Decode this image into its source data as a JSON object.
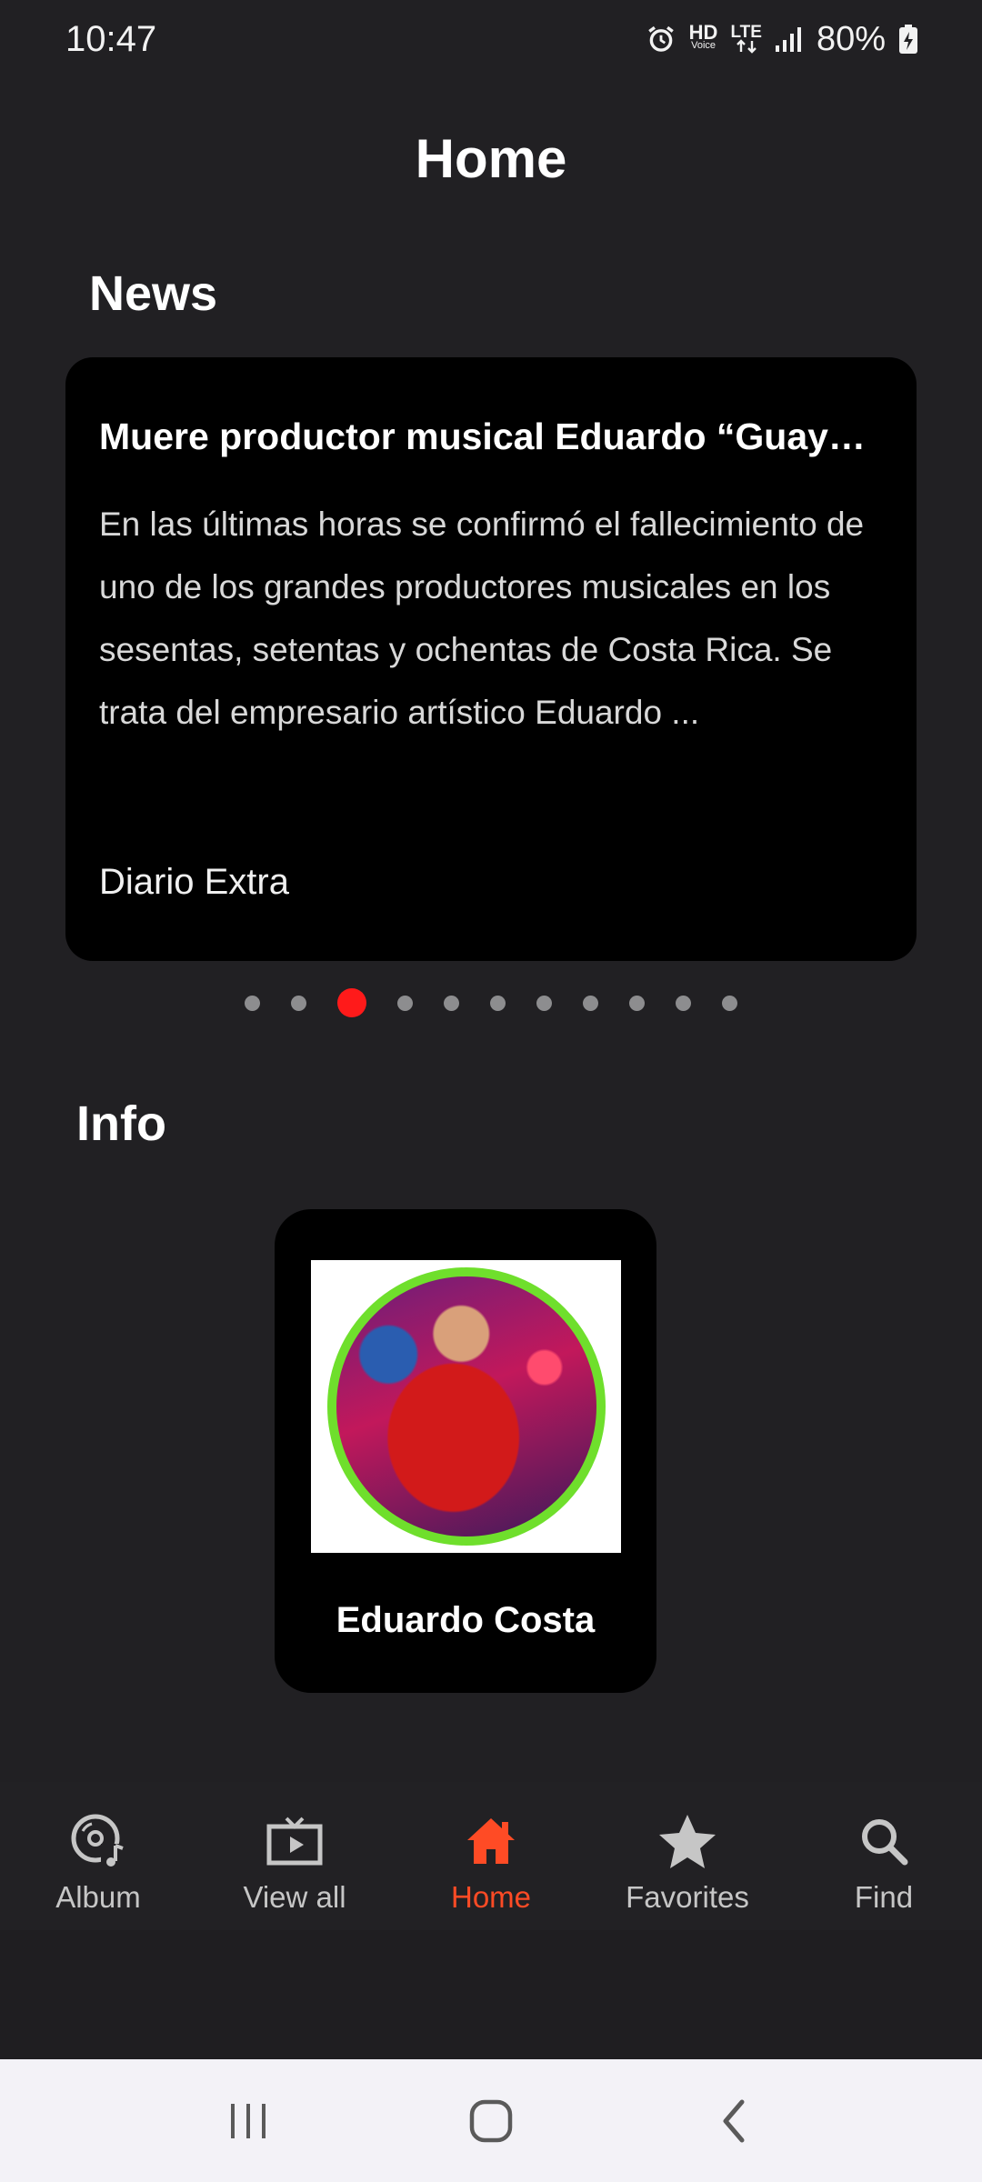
{
  "status_bar": {
    "time": "10:47",
    "hd_label_top": "HD",
    "hd_label_bottom": "Voice",
    "lte_label": "LTE",
    "battery": "80%",
    "icons": [
      "alarm-icon",
      "hd-voice-icon",
      "lte-icon",
      "signal-icon",
      "battery-charging-icon"
    ]
  },
  "header": {
    "title": "Home"
  },
  "news": {
    "section_title": "News",
    "card": {
      "headline": "Muere productor musical Eduardo “Guay…",
      "body": "En las últimas horas se confirmó el fallecimiento de uno de los grandes productores musicales en los sesentas, setentas y ochentas de Costa Rica. Se trata del empresario artístico Eduardo ...",
      "source": "Diario Extra"
    },
    "pager": {
      "count": 11,
      "active_index": 2
    }
  },
  "info": {
    "section_title": "Info",
    "card": {
      "name": "Eduardo Costa"
    }
  },
  "bottom_nav": {
    "items": [
      {
        "label": "Album",
        "icon": "album-music-icon"
      },
      {
        "label": "View all",
        "icon": "tv-play-icon"
      },
      {
        "label": "Home",
        "icon": "home-icon"
      },
      {
        "label": "Favorites",
        "icon": "star-icon"
      },
      {
        "label": "Find",
        "icon": "search-icon"
      }
    ],
    "active": "Home",
    "active_color": "#ff4b25",
    "inactive_color": "#c6c6c6"
  },
  "system_nav": {
    "icons": [
      "recent-apps-icon",
      "home-circle-icon",
      "back-icon"
    ]
  },
  "colors": {
    "background": "#212023",
    "card": "#000000",
    "pager_active": "#ff1a1a",
    "avatar_ring": "#6fdf2c"
  }
}
